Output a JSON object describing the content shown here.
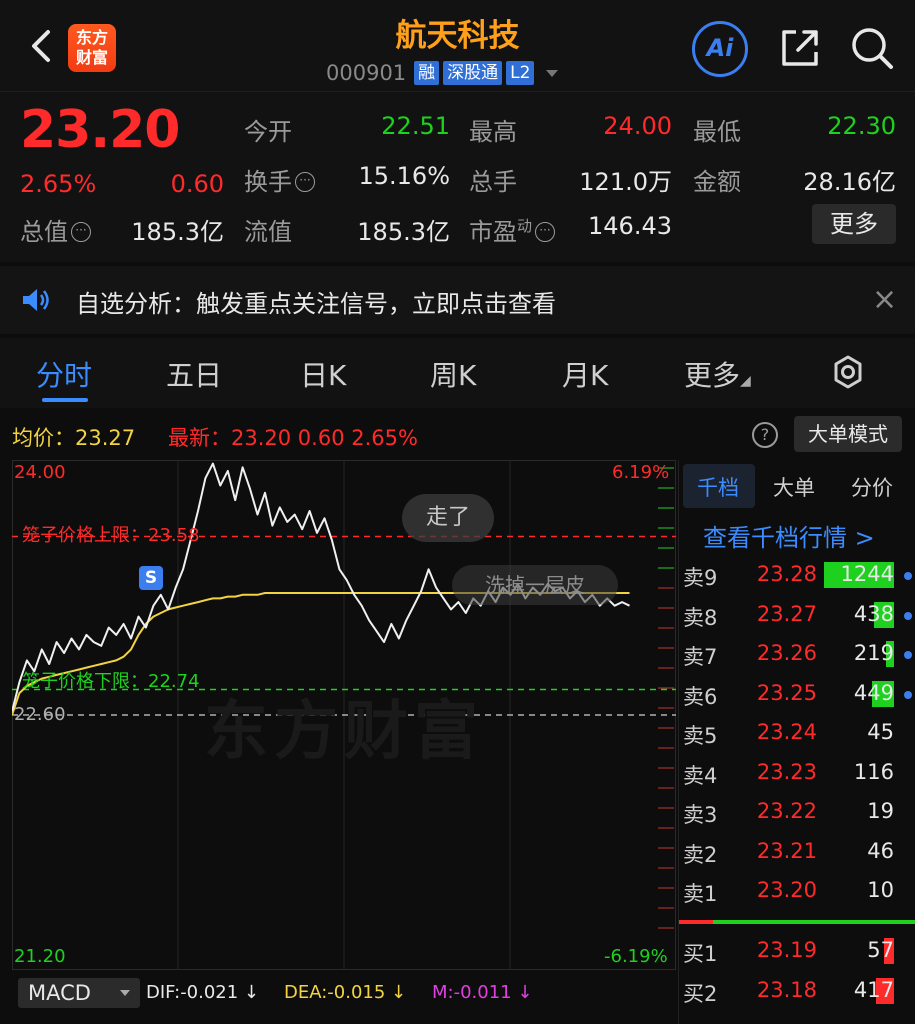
{
  "header": {
    "logo_line1": "东方",
    "logo_line2": "财富",
    "stock_name": "航天科技",
    "code": "000901",
    "tags": [
      "融",
      "深股通",
      "L2"
    ],
    "ai_label": "Ai"
  },
  "quote": {
    "price": "23.20",
    "change_pct": "2.65%",
    "change": "0.60",
    "open_label": "今开",
    "open": "22.51",
    "high_label": "最高",
    "high": "24.00",
    "low_label": "最低",
    "low": "22.30",
    "turnover_label": "换手",
    "turnover": "15.16%",
    "volume_label": "总手",
    "volume": "121.0万",
    "amount_label": "金额",
    "amount": "28.16亿",
    "total_cap_label": "总值",
    "total_cap": "185.3亿",
    "float_cap_label": "流值",
    "float_cap": "185.3亿",
    "pe_label": "市盈",
    "pe_super": "动",
    "pe": "146.43",
    "more_label": "更多"
  },
  "notice": {
    "text": "自选分析：触发重点关注信号，立即点击查看"
  },
  "tabs": [
    "分时",
    "五日",
    "日K",
    "周K",
    "月K",
    "更多"
  ],
  "chart_header": {
    "avg_text": "均价：23.27",
    "latest_text": "最新：23.20  0.60  2.65%",
    "help": "?",
    "bigorder_btn": "大单模式"
  },
  "chart_labels": {
    "high": "24.00",
    "low": "21.20",
    "prev_close": "22.60",
    "pct_high": "6.19%",
    "pct_low": "-6.19%",
    "cage_upper": "笼子价格上限：23.58",
    "cage_lower": "笼子价格下限：22.74",
    "bubble1": "走了",
    "bubble2": "洗掉一层皮",
    "watermark": "东方财富",
    "s_badge": "S"
  },
  "chart_data": {
    "type": "line",
    "y_range": [
      21.2,
      24.0
    ],
    "prev_close": 22.6,
    "series": [
      {
        "values": [
          22.62,
          22.78,
          22.9,
          22.84,
          22.96,
          22.88,
          23.0,
          22.94,
          23.02,
          22.96,
          23.04,
          23.0,
          22.98,
          23.08,
          23.04,
          23.1,
          23.02,
          23.14,
          23.08,
          23.2,
          23.26,
          23.18,
          23.3,
          23.4,
          23.56,
          23.72,
          23.9,
          23.98,
          23.86,
          23.94,
          23.78,
          23.96,
          23.84,
          23.7,
          23.82,
          23.64,
          23.74,
          23.66,
          23.7,
          23.62,
          23.72,
          23.6,
          23.68,
          23.56,
          23.4,
          23.34,
          23.26,
          23.2,
          23.12,
          23.06,
          23.0,
          23.1,
          23.02,
          23.12,
          23.2,
          23.28,
          23.4,
          23.3,
          23.24,
          23.18,
          23.22,
          23.16,
          23.24,
          23.2,
          23.28,
          23.22,
          23.3,
          23.26,
          23.32,
          23.24,
          23.3,
          23.26,
          23.32,
          23.28,
          23.3,
          23.24,
          23.28,
          23.22,
          23.26,
          23.2,
          23.24,
          23.2,
          23.22,
          23.2
        ]
      },
      {
        "values": [
          22.6,
          22.72,
          22.76,
          22.78,
          22.8,
          22.81,
          22.82,
          22.83,
          22.84,
          22.85,
          22.86,
          22.87,
          22.88,
          22.89,
          22.9,
          22.92,
          22.96,
          23.04,
          23.1,
          23.14,
          23.16,
          23.18,
          23.19,
          23.2,
          23.21,
          23.22,
          23.23,
          23.24,
          23.24,
          23.25,
          23.25,
          23.26,
          23.26,
          23.26,
          23.27,
          23.27,
          23.27,
          23.27,
          23.27,
          23.27,
          23.27,
          23.27,
          23.27,
          23.27,
          23.27,
          23.27,
          23.27,
          23.27,
          23.27,
          23.27,
          23.27,
          23.27,
          23.27,
          23.27,
          23.27,
          23.27,
          23.27,
          23.27,
          23.27,
          23.27,
          23.27,
          23.27,
          23.27,
          23.27,
          23.27,
          23.27,
          23.27,
          23.27,
          23.27,
          23.27,
          23.27,
          23.27,
          23.27,
          23.27,
          23.27,
          23.27,
          23.27,
          23.27,
          23.27,
          23.27,
          23.27,
          23.27,
          23.27,
          23.27
        ]
      }
    ],
    "reference_lines": [
      {
        "value": 23.58,
        "label": "笼子价格上限：23.58"
      },
      {
        "value": 22.74,
        "label": "笼子价格下限：22.74"
      },
      {
        "value": 22.6,
        "label": "22.60"
      }
    ]
  },
  "book": {
    "tabs": [
      "千档",
      "大单",
      "分价"
    ],
    "link": "查看千档行情 >",
    "asks": [
      {
        "label": "卖9",
        "price": "23.28",
        "vol": "1244",
        "bar": 0.7
      },
      {
        "label": "卖8",
        "price": "23.27",
        "vol": "438",
        "bar": 0.2
      },
      {
        "label": "卖7",
        "price": "23.26",
        "vol": "219",
        "bar": 0.08
      },
      {
        "label": "卖6",
        "price": "23.25",
        "vol": "449",
        "bar": 0.22
      },
      {
        "label": "卖5",
        "price": "23.24",
        "vol": "45",
        "bar": 0.0
      },
      {
        "label": "卖4",
        "price": "23.23",
        "vol": "116",
        "bar": 0.0
      },
      {
        "label": "卖3",
        "price": "23.22",
        "vol": "19",
        "bar": 0.0
      },
      {
        "label": "卖2",
        "price": "23.21",
        "vol": "46",
        "bar": 0.0
      },
      {
        "label": "卖1",
        "price": "23.20",
        "vol": "10",
        "bar": 0.0
      }
    ],
    "bids": [
      {
        "label": "买1",
        "price": "23.19",
        "vol": "57",
        "bar": 0.1
      },
      {
        "label": "买2",
        "price": "23.18",
        "vol": "417",
        "bar": 0.18
      }
    ]
  },
  "macd": {
    "selector": "MACD",
    "dif": "DIF:-0.021 ↓",
    "dea": "DEA:-0.015 ↓",
    "m": "M:-0.011 ↓"
  },
  "colors": {
    "up": "#ff2a2a",
    "down": "#1fd11f",
    "accent": "#3b8cff",
    "brand": "#ff9f1a",
    "avg_line": "#f2d442"
  }
}
